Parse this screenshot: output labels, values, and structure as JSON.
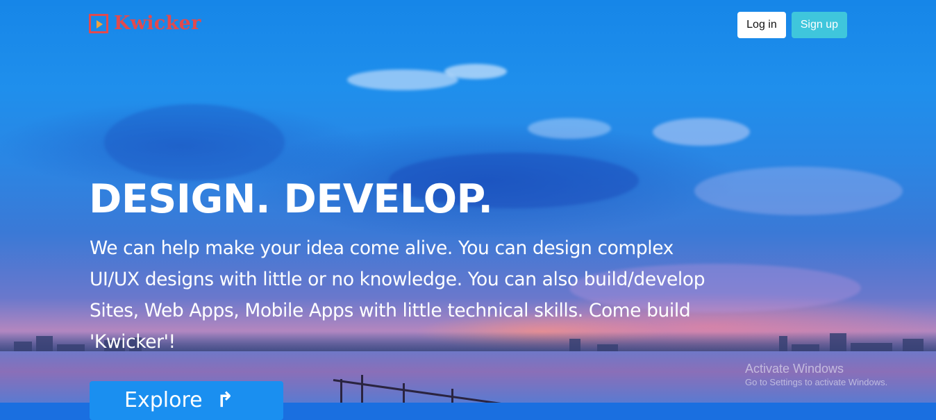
{
  "brand": {
    "name": "Kwicker",
    "icon": "play-icon",
    "color": "#e24a4e"
  },
  "nav": {
    "login_label": "Log in",
    "signup_label": "Sign up",
    "signup_color": "#3fc6dc"
  },
  "hero": {
    "headline": "DESIGN. DEVELOP.",
    "lead": "We can help make your idea come alive. You can design complex UI/UX designs with little or no knowledge. You can also build/develop Sites, Web Apps, Mobile Apps with little technical skills. Come build 'Kwicker'!",
    "explore_label": "Explore",
    "explore_icon": "arrow-icon",
    "button_color": "#1a8ff0"
  },
  "watermark": {
    "title": "Activate Windows",
    "subtitle": "Go to Settings to activate Windows."
  }
}
